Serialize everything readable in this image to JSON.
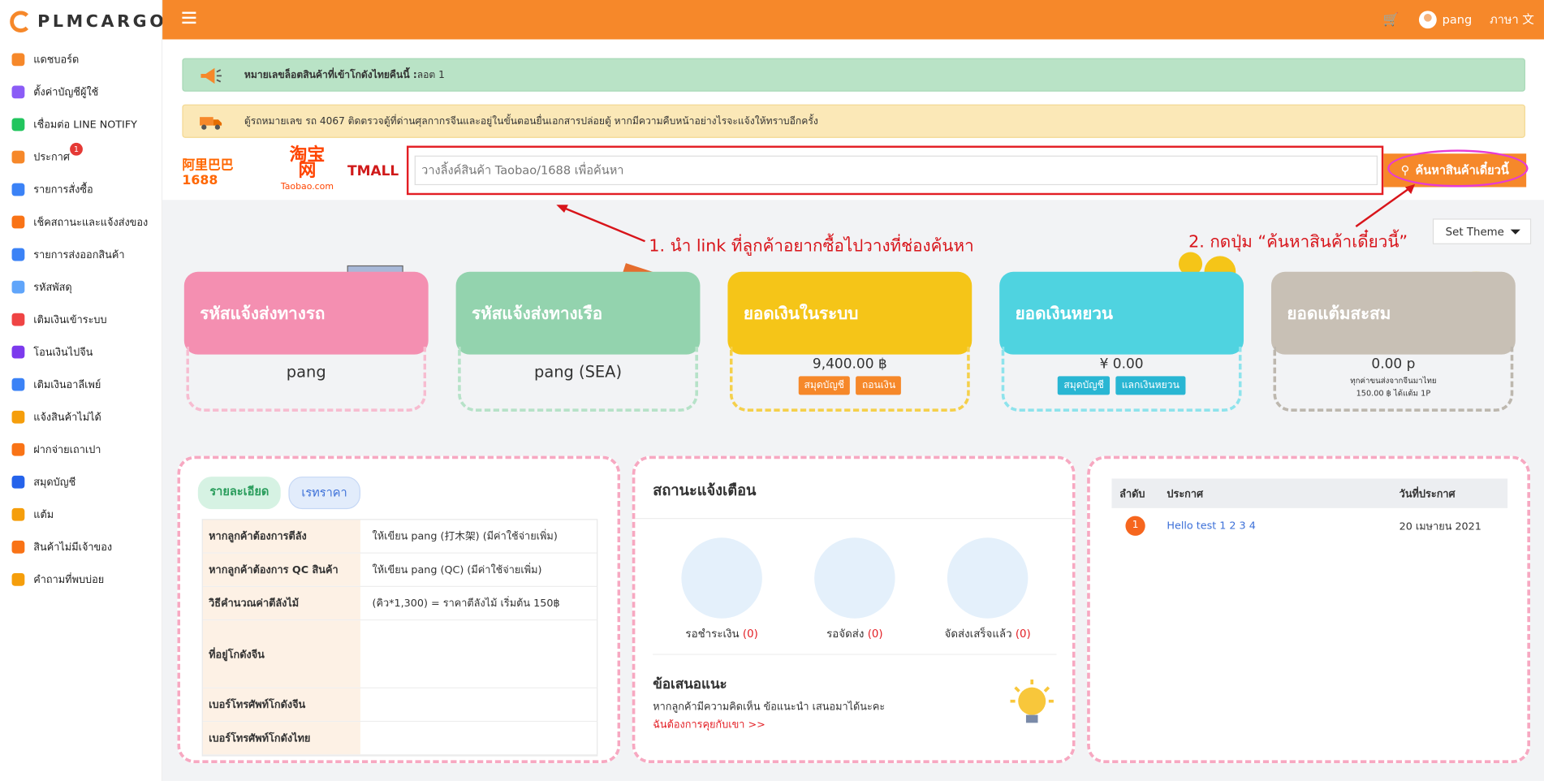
{
  "brand": "PLMCARGO",
  "sidebar": {
    "items": [
      {
        "label": "แดชบอร์ด",
        "color": "#f6882a"
      },
      {
        "label": "ตั้งค่าบัญชีผู้ใช้",
        "color": "#8b5cf6"
      },
      {
        "label": "เชื่อมต่อ LINE NOTIFY",
        "color": "#22c55e"
      },
      {
        "label": "ประกาศ",
        "color": "#f6882a",
        "badge": "1"
      },
      {
        "label": "รายการสั่งซื้อ",
        "color": "#3b82f6"
      },
      {
        "label": "เช็คสถานะและแจ้งส่งของ",
        "color": "#f97316"
      },
      {
        "label": "รายการส่งออกสินค้า",
        "color": "#3b82f6"
      },
      {
        "label": "รหัสพัสดุ",
        "color": "#60a5fa"
      },
      {
        "label": "เติมเงินเข้าระบบ",
        "color": "#ef4444"
      },
      {
        "label": "โอนเงินไปจีน",
        "color": "#7c3aed"
      },
      {
        "label": "เติมเงินอาลีเพย์",
        "color": "#3b82f6"
      },
      {
        "label": "แจ้งสินค้าไม่ได้",
        "color": "#f59e0b"
      },
      {
        "label": "ฝากจ่ายเถาเปา",
        "color": "#f97316"
      },
      {
        "label": "สมุดบัญชี",
        "color": "#2563eb"
      },
      {
        "label": "แต้ม",
        "color": "#f59e0b"
      },
      {
        "label": "สินค้าไม่มีเจ้าของ",
        "color": "#f97316"
      },
      {
        "label": "คำถามที่พบบ่อย",
        "color": "#f59e0b"
      }
    ]
  },
  "header": {
    "user": "pang",
    "language": "ภาษา",
    "cart_icon": "cart-icon",
    "lang_icon": "translate-icon"
  },
  "alerts": {
    "lot_label": "หมายเลขล็อตสินค้าที่เข้าโกดังไทยคืนนี้ :",
    "lot_value": " ลอต 1",
    "truck_msg": "ตู้รถหมายเลข รถ 4067 ติดตรวจตู้ที่ด่านศุลกากรจีนและอยู่ในขั้นตอนยื่นเอกสารปล่อยตู้ หากมีความคืบหน้าอย่างไรจะแจ้งให้ทราบอีกครั้ง"
  },
  "search": {
    "placeholder": "วางลิ้งค์สินค้า Taobao/1688 เพื่อค้นหา",
    "button": "ค้นหาสินค้าเดี๋ยวนี้",
    "logos": {
      "l1688": "阿里巴巴 1688",
      "taobao": "淘宝网",
      "taobao_sub": "Taobao.com",
      "tmall": "TMALL"
    }
  },
  "annotations": {
    "a1": "1. นำ link ที่ลูกค้าอยากซื้อไปวางที่ช่องค้นหา",
    "a2": "2. กดปุ่ม “ค้นหาสินค้าเดี๋ยวนี้”"
  },
  "theme": {
    "label": "Set Theme"
  },
  "cards": [
    {
      "title": "รหัสแจ้งส่งทางรถ",
      "value": "pang",
      "color": "#f48fb1",
      "dash": "#f7bcd0"
    },
    {
      "title": "รหัสแจ้งส่งทางเรือ",
      "value": "pang (SEA)",
      "color": "#93d3ae",
      "dash": "#b6e2c8"
    },
    {
      "title": "ยอดเงินในระบบ",
      "value": "9,400.00 ฿",
      "color": "#f5c518",
      "dash": "#f5d04b",
      "btn1": "สมุดบัญชี",
      "btn2": "ถอนเงิน",
      "btncolor": "#f6882a"
    },
    {
      "title": "ยอดเงินหยวน",
      "value": "¥ 0.00",
      "color": "#4fd3e0",
      "dash": "#8ee3ec",
      "btn1": "สมุดบัญชี",
      "btn2": "แลกเงินหยวน",
      "btncolor": "#29b6d3"
    },
    {
      "title": "ยอดแต้มสะสม",
      "value": "0.00 p",
      "color": "#c8c0b5",
      "dash": "#bdb7ae",
      "note1": "ทุกค่าขนส่งจากจีนมาไทย",
      "note2": "150.00 ฿ ได้แต้ม 1P"
    }
  ],
  "details": {
    "tab1": "รายละเอียด",
    "tab2": "เรทราคา",
    "rows": [
      {
        "k": "หากลูกค้าต้องการตีลัง",
        "v": "ให้เขียน pang (打木架) (มีค่าใช้จ่ายเพิ่ม)"
      },
      {
        "k": "หากลูกค้าต้องการ QC สินค้า",
        "v": "ให้เขียน pang (QC) (มีค่าใช้จ่ายเพิ่ม)"
      },
      {
        "k": "วิธีคำนวณค่าตีลังไม้",
        "v": "(คิว*1,300) = ราคาตีลังไม้ เริ่มต้น 150฿"
      },
      {
        "k": "ที่อยู่โกดังจีน",
        "v": ""
      },
      {
        "k": "เบอร์โทรศัพท์โกดังจีน",
        "v": ""
      },
      {
        "k": "เบอร์โทรศัพท์โกดังไทย",
        "v": ""
      }
    ]
  },
  "status": {
    "title": "สถานะแจ้งเตือน",
    "items": [
      {
        "label": "รอชำระเงิน",
        "count": "(0)"
      },
      {
        "label": "รอจัดส่ง",
        "count": "(0)"
      },
      {
        "label": "จัดส่งเสร็จแล้ว",
        "count": "(0)"
      }
    ],
    "suggest_title": "ข้อเสนอแนะ",
    "suggest_text": "หากลูกค้ามีความคิดเห็น ข้อแนะนำ เสนอมาได้นะคะ",
    "suggest_link": "ฉันต้องการคุยกับเขา >>"
  },
  "announcements": {
    "headers": [
      "ลำดับ",
      "ประกาศ",
      "วันที่ประกาศ"
    ],
    "rows": [
      {
        "no": "1",
        "title": "Hello test 1 2 3 4",
        "date": "20 เมษายน 2021"
      }
    ]
  }
}
